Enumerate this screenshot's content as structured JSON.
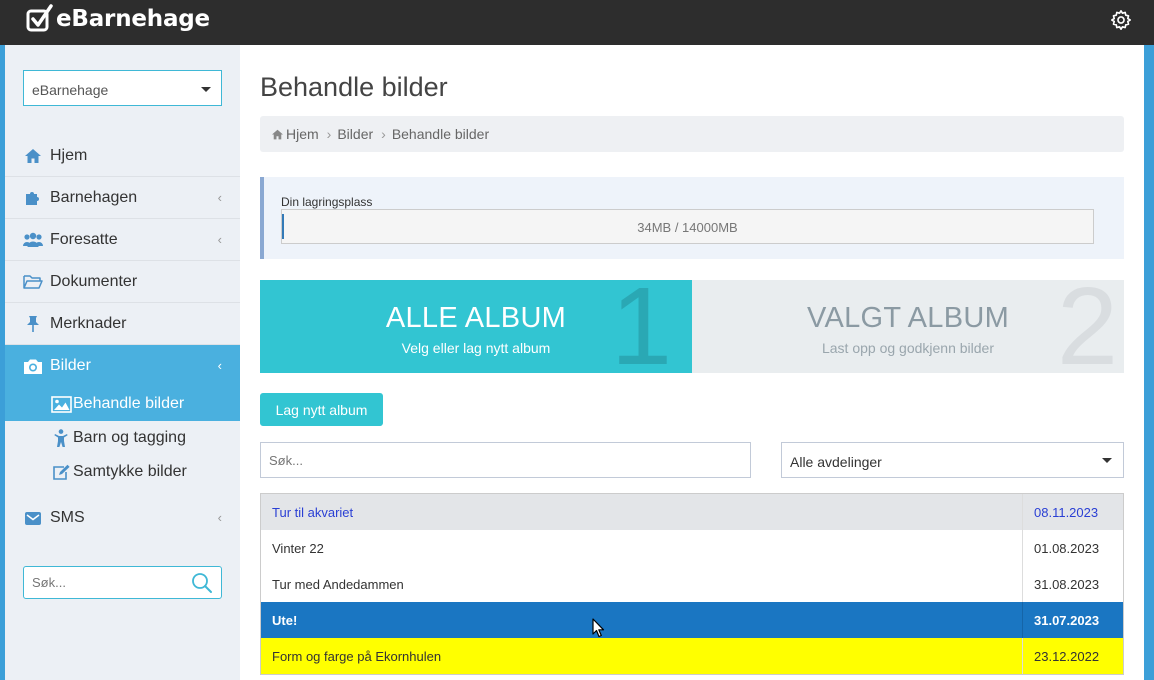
{
  "app": {
    "name": "eBarnehage"
  },
  "colors": {
    "accent": "#32c5d2",
    "sidebar_active": "#4ab0df",
    "selected_row": "#1a76c2",
    "highlight_row": "#ffff00",
    "topbar": "#2d2d2d"
  },
  "header": {
    "settings_icon": "gear-icon"
  },
  "sidebar": {
    "site_select": "eBarnehage",
    "items": [
      {
        "label": "Hjem",
        "icon": "home-icon"
      },
      {
        "label": "Barnehagen",
        "icon": "puzzle-icon"
      },
      {
        "label": "Foresatte",
        "icon": "users-icon"
      },
      {
        "label": "Dokumenter",
        "icon": "folder-icon"
      },
      {
        "label": "Merknader",
        "icon": "pin-icon"
      },
      {
        "label": "Bilder",
        "icon": "camera-icon"
      },
      {
        "label": "SMS",
        "icon": "envelope-icon"
      }
    ],
    "sub_items": [
      {
        "label": "Behandle bilder",
        "icon": "image-icon"
      },
      {
        "label": "Barn og tagging",
        "icon": "child-icon"
      },
      {
        "label": "Samtykke bilder",
        "icon": "edit-icon"
      }
    ],
    "search_placeholder": "Søk..."
  },
  "main": {
    "title": "Behandle bilder",
    "breadcrumb": [
      "Hjem",
      "Bilder",
      "Behandle bilder"
    ],
    "storage": {
      "label": "Din lagringsplass",
      "text": "34MB / 14000MB",
      "used_mb": 34,
      "total_mb": 14000
    },
    "steps": [
      {
        "number": "1",
        "title": "ALLE ALBUM",
        "desc": "Velg eller lag nytt album"
      },
      {
        "number": "2",
        "title": "VALGT ALBUM",
        "desc": "Last opp og godkjenn bilder"
      }
    ],
    "new_album_button": "Lag nytt album",
    "search_placeholder": "Søk...",
    "department_select": "Alle avdelinger",
    "albums": [
      {
        "name": "Tur til akvariet",
        "date": "08.11.2023"
      },
      {
        "name": "Vinter 22",
        "date": "01.08.2023"
      },
      {
        "name": "Tur med Andedammen",
        "date": "31.08.2023"
      },
      {
        "name": "Ute!",
        "date": "31.07.2023"
      },
      {
        "name": "Form og farge på Ekornhulen",
        "date": "23.12.2022"
      }
    ]
  }
}
